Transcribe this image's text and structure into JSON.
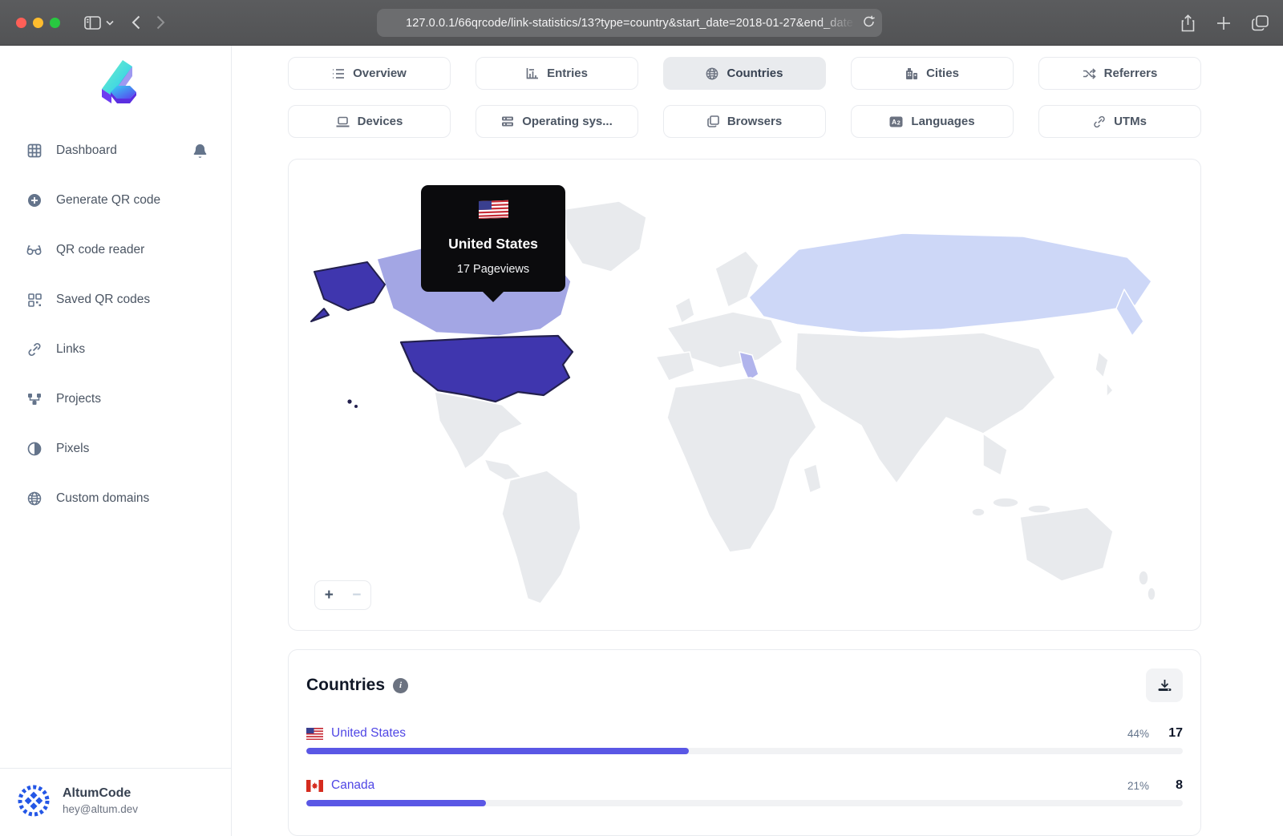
{
  "browser": {
    "url": "127.0.0.1/66qrcode/link-statistics/13?type=country&start_date=2018-01-27&end_date",
    "buttons": {
      "back": "back",
      "forward": "forward",
      "reload": "⟳",
      "share": "share",
      "new_tab": "+",
      "tabs_overview": "tabs"
    }
  },
  "sidebar": {
    "items": [
      {
        "label": "Dashboard",
        "icon": "grid-icon"
      },
      {
        "label": "Generate QR code",
        "icon": "plus-circle-icon"
      },
      {
        "label": "QR code reader",
        "icon": "glasses-icon"
      },
      {
        "label": "Saved QR codes",
        "icon": "qr-icon"
      },
      {
        "label": "Links",
        "icon": "link-icon"
      },
      {
        "label": "Projects",
        "icon": "nodes-icon"
      },
      {
        "label": "Pixels",
        "icon": "contrast-icon"
      },
      {
        "label": "Custom domains",
        "icon": "globe-icon"
      }
    ],
    "user": {
      "name": "AltumCode",
      "email": "hey@altum.dev"
    }
  },
  "tabs": [
    {
      "label": "Overview",
      "active": false
    },
    {
      "label": "Entries",
      "active": false
    },
    {
      "label": "Countries",
      "active": true
    },
    {
      "label": "Cities",
      "active": false
    },
    {
      "label": "Referrers",
      "active": false
    },
    {
      "label": "Devices",
      "active": false
    },
    {
      "label": "Operating sys...",
      "active": false
    },
    {
      "label": "Browsers",
      "active": false
    },
    {
      "label": "Languages",
      "active": false
    },
    {
      "label": "UTMs",
      "active": false
    }
  ],
  "map": {
    "tooltip": {
      "country": "United States",
      "pageviews": "17 Pageviews"
    },
    "zoom_in": "+",
    "zoom_out": "−",
    "highlight_colors": {
      "united_states": "#3f36ae",
      "canada": "#a3a6e4",
      "italy": "#b1b4ec",
      "russia": "#cdd7f7",
      "land": "#e8eaed"
    }
  },
  "countries_panel": {
    "title": "Countries",
    "rows": [
      {
        "country": "United States",
        "percent": "44%",
        "count": "17",
        "bar_pct": 43.6
      },
      {
        "country": "Canada",
        "percent": "21%",
        "count": "8",
        "bar_pct": 20.5
      }
    ]
  },
  "colors": {
    "accent": "#4f46e5",
    "bar_fill": "#5a57e5",
    "traffic_red": "#ff5f57",
    "traffic_yellow": "#febc2e",
    "traffic_green": "#28c840"
  }
}
